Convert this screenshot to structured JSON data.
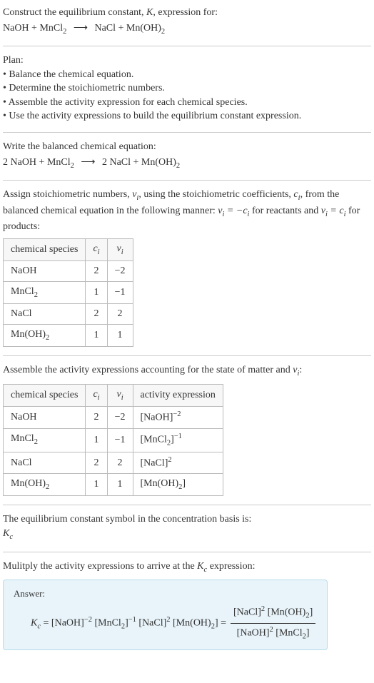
{
  "header": {
    "prompt_line1": "Construct the equilibrium constant, ",
    "prompt_K": "K",
    "prompt_line1b": ", expression for:",
    "reaction_lhs": "NaOH + MnCl",
    "reaction_arrow": "⟶",
    "reaction_rhs": "NaCl + Mn(OH)"
  },
  "plan": {
    "title": "Plan:",
    "items": [
      "• Balance the chemical equation.",
      "• Determine the stoichiometric numbers.",
      "• Assemble the activity expression for each chemical species.",
      "• Use the activity expressions to build the equilibrium constant expression."
    ]
  },
  "balanced": {
    "title": "Write the balanced chemical equation:",
    "lhs_coeff1": "2 NaOH + MnCl",
    "arrow": "⟶",
    "rhs": "2 NaCl + Mn(OH)"
  },
  "assign": {
    "text1": "Assign stoichiometric numbers, ",
    "nu_i": "ν",
    "text2": ", using the stoichiometric coefficients, ",
    "c_i": "c",
    "text3": ", from the balanced chemical equation in the following manner: ",
    "rel1a": "ν",
    "rel1b": " = −c",
    "text4": " for reactants and ",
    "rel2a": "ν",
    "rel2b": " = c",
    "text5": " for products:",
    "table": {
      "headers": [
        "chemical species",
        "c",
        "ν"
      ],
      "rows": [
        {
          "species": "NaOH",
          "c": "2",
          "nu": "−2"
        },
        {
          "species": "MnCl",
          "sub": "2",
          "c": "1",
          "nu": "−1"
        },
        {
          "species": "NaCl",
          "c": "2",
          "nu": "2"
        },
        {
          "species": "Mn(OH)",
          "sub": "2",
          "c": "1",
          "nu": "1"
        }
      ]
    }
  },
  "activity": {
    "title": "Assemble the activity expressions accounting for the state of matter and ",
    "nu": "ν",
    "title_end": ":",
    "table": {
      "headers": [
        "chemical species",
        "c",
        "ν",
        "activity expression"
      ],
      "rows": [
        {
          "species": "NaOH",
          "c": "2",
          "nu": "−2",
          "expr_base": "[NaOH]",
          "exp": "−2"
        },
        {
          "species": "MnCl",
          "sub": "2",
          "c": "1",
          "nu": "−1",
          "expr_base": "[MnCl",
          "expr_sub": "2",
          "expr_close": "]",
          "exp": "−1"
        },
        {
          "species": "NaCl",
          "c": "2",
          "nu": "2",
          "expr_base": "[NaCl]",
          "exp": "2"
        },
        {
          "species": "Mn(OH)",
          "sub": "2",
          "c": "1",
          "nu": "1",
          "expr_base": "[Mn(OH)",
          "expr_sub": "2",
          "expr_close": "]"
        }
      ]
    }
  },
  "kc_symbol": {
    "line1": "The equilibrium constant symbol in the concentration basis is:",
    "symbol": "K",
    "sub": "c"
  },
  "multiply": {
    "line": "Mulitply the activity expressions to arrive at the ",
    "kc": "K",
    "sub": "c",
    "line_end": " expression:"
  },
  "answer": {
    "label": "Answer:",
    "kc": "K",
    "kc_sub": "c",
    "eq": " = ",
    "t1": "[NaOH]",
    "e1": "−2",
    "t2": " [MnCl",
    "t2sub": "2",
    "t2b": "]",
    "e2": "−1",
    "t3": " [NaCl]",
    "e3": "2",
    "t4": " [Mn(OH)",
    "t4sub": "2",
    "t4b": "] = ",
    "num1": "[NaCl]",
    "num1e": "2",
    "num2": " [Mn(OH)",
    "num2sub": "2",
    "num2b": "]",
    "den1": "[NaOH]",
    "den1e": "2",
    "den2": " [MnCl",
    "den2sub": "2",
    "den2b": "]"
  },
  "chart_data": {
    "type": "table",
    "stoichiometry_table": {
      "columns": [
        "chemical species",
        "c_i",
        "ν_i"
      ],
      "rows": [
        [
          "NaOH",
          2,
          -2
        ],
        [
          "MnCl2",
          1,
          -1
        ],
        [
          "NaCl",
          2,
          2
        ],
        [
          "Mn(OH)2",
          1,
          1
        ]
      ]
    },
    "activity_table": {
      "columns": [
        "chemical species",
        "c_i",
        "ν_i",
        "activity expression"
      ],
      "rows": [
        [
          "NaOH",
          2,
          -2,
          "[NaOH]^-2"
        ],
        [
          "MnCl2",
          1,
          -1,
          "[MnCl2]^-1"
        ],
        [
          "NaCl",
          2,
          2,
          "[NaCl]^2"
        ],
        [
          "Mn(OH)2",
          1,
          1,
          "[Mn(OH)2]"
        ]
      ]
    }
  }
}
